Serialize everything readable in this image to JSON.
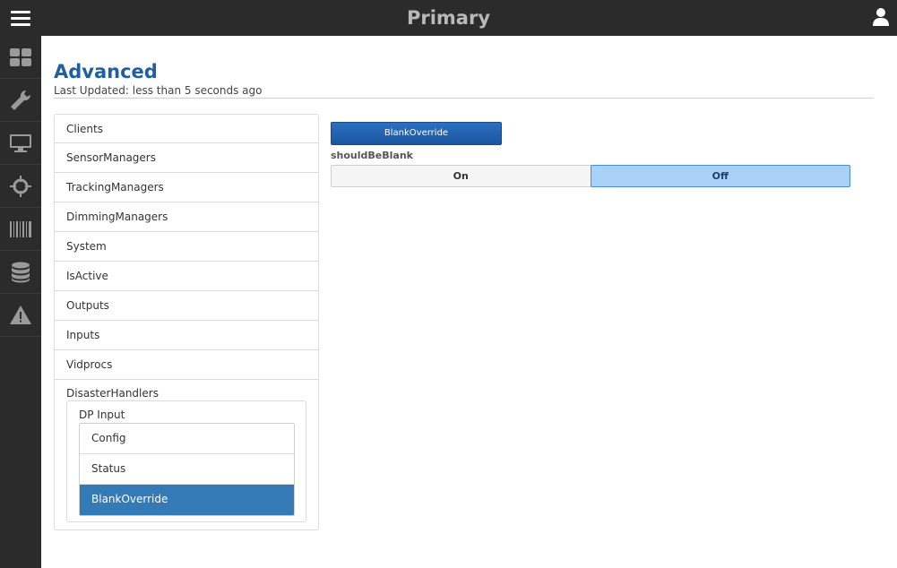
{
  "header": {
    "title": "Primary"
  },
  "sidebar": {
    "items": [
      {
        "name": "dashboard-icon",
        "label": "Dashboard"
      },
      {
        "name": "wrench-icon",
        "label": "Tools"
      },
      {
        "name": "monitor-icon",
        "label": "Displays"
      },
      {
        "name": "crosshair-icon",
        "label": "Tracking"
      },
      {
        "name": "barcode-icon",
        "label": "Barcode"
      },
      {
        "name": "database-icon",
        "label": "Database"
      },
      {
        "name": "warning-icon",
        "label": "Alerts"
      }
    ]
  },
  "page": {
    "title": "Advanced",
    "last_updated": "Last Updated: less than 5 seconds ago"
  },
  "nav": {
    "items": [
      "Clients",
      "SensorManagers",
      "TrackingManagers",
      "DimmingManagers",
      "System",
      "IsActive",
      "Outputs",
      "Inputs",
      "Vidprocs",
      "DisasterHandlers"
    ],
    "group": {
      "title": "DP Input",
      "items": [
        "Config",
        "Status",
        "BlankOverride"
      ],
      "active_index": 2
    }
  },
  "content": {
    "button_label": "BlankOverride",
    "field_label": "shouldBeBlank",
    "toggle": {
      "on_label": "On",
      "off_label": "Off",
      "selected": "Off"
    }
  },
  "colors": {
    "title_blue": "#1f5fa0",
    "active_blue": "#337ab7",
    "toggle_selected": "#a9d0f5",
    "bar_dark": "#2b2b2b"
  }
}
